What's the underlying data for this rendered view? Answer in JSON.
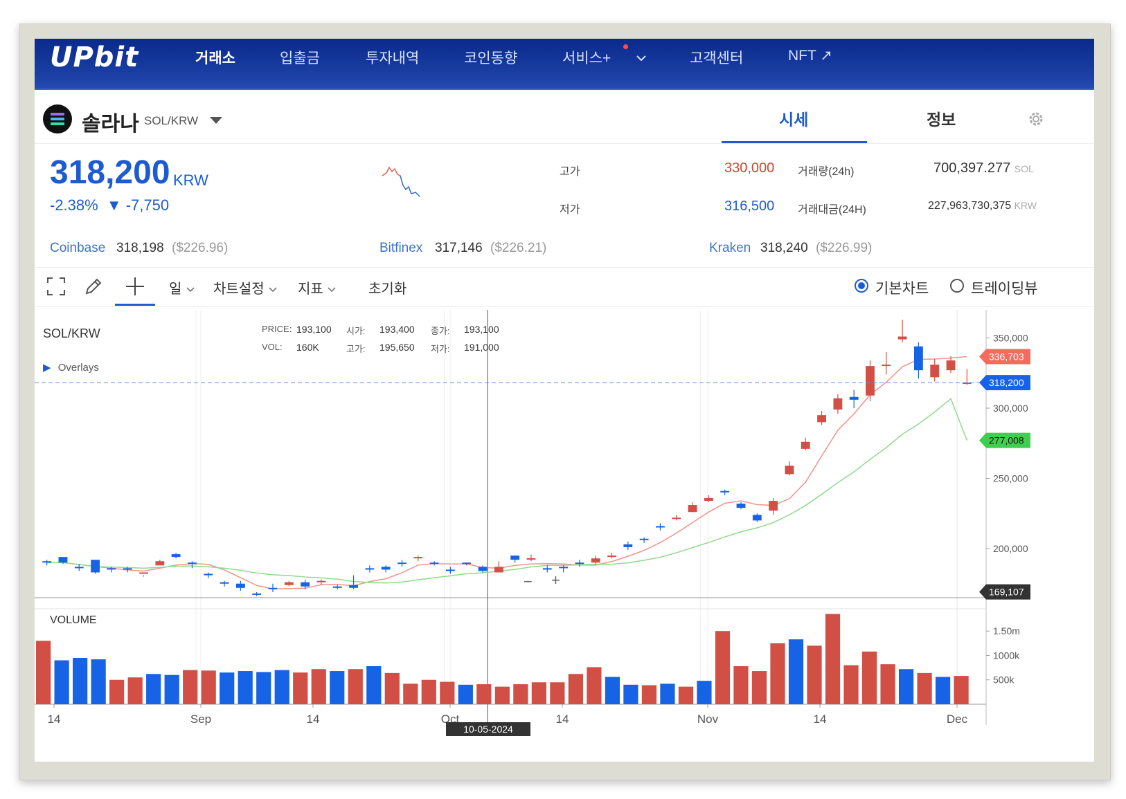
{
  "nav": {
    "logo": "UPbit",
    "items": [
      {
        "label": "거래소",
        "active": true
      },
      {
        "label": "입출금",
        "active": false
      },
      {
        "label": "투자내역",
        "active": false
      },
      {
        "label": "코인동향",
        "active": false
      },
      {
        "label": "서비스+",
        "active": false
      },
      {
        "label": "고객센터",
        "active": false
      },
      {
        "label": "NFT ↗",
        "active": false
      }
    ]
  },
  "coin": {
    "name": "솔라나",
    "pair": "SOL/KRW",
    "tabs": [
      "시세",
      "정보"
    ]
  },
  "price": {
    "current": "318,200",
    "unit": "KRW",
    "change_pct": "-2.38%",
    "change_abs": "▼ -7,750"
  },
  "stats": {
    "high_label": "고가",
    "high": "330,000",
    "low_label": "저가",
    "low": "316,500",
    "volume_label": "거래량(24h)",
    "volume": "700,397.277",
    "volume_unit": "SOL",
    "amount_label": "거래대금(24H)",
    "amount": "227,963,730,375",
    "amount_unit": "KRW"
  },
  "exchanges": [
    {
      "name": "Coinbase",
      "price": "318,198",
      "usd": "($226.96)"
    },
    {
      "name": "Bitfinex",
      "price": "317,146",
      "usd": "($226.21)"
    },
    {
      "name": "Kraken",
      "price": "318,240",
      "usd": "($226.99)"
    }
  ],
  "toolbar": {
    "interval": "일",
    "chart_settings": "차트설정",
    "indicators": "지표",
    "reset": "초기화",
    "basic_chart": "기본차트",
    "tradingview": "트레이딩뷰"
  },
  "chart_data": {
    "type": "candlestick",
    "symbol": "SOL/KRW",
    "overlays_label": "Overlays",
    "volume_label": "VOLUME",
    "tooltip": {
      "price_label": "PRICE:",
      "price": "193,100",
      "open_label": "시가:",
      "open": "193,400",
      "close_label": "종가:",
      "close": "193,100",
      "vol_label": "VOL:",
      "vol": "160K",
      "high_label": "고가:",
      "high": "195,650",
      "low_label": "저가:",
      "low": "191,000"
    },
    "y_ticks": [
      "350,000",
      "300,000",
      "250,000",
      "200,000"
    ],
    "y_tick_values": [
      350000,
      300000,
      250000,
      200000
    ],
    "ylim": [
      165000,
      368000
    ],
    "vol_ticks": [
      "1.50m",
      "1000k",
      "500k"
    ],
    "vol_tick_values": [
      1500000,
      1000000,
      500000
    ],
    "vol_max": 1900000,
    "x_labels": [
      "14",
      "Sep",
      "14",
      "Oct",
      "14",
      "Nov",
      "14",
      "Dec"
    ],
    "x_label_index": [
      0,
      19,
      33,
      49,
      63,
      80,
      94,
      111
    ],
    "crosshair_date": "10-05-2024",
    "crosshair_index": 53,
    "current_price": 318200,
    "current_price_label": "318,200",
    "ma_short_last": 336703,
    "ma_short_label": "336,703",
    "ma_long_last": 277008,
    "ma_long_label": "277,008",
    "bottom_marker": 169107,
    "bottom_marker_label": "169,107",
    "candles": [
      [
        185000,
        190000,
        183000,
        191000,
        180000,
        191000,
        190000,
        192000,
        188000
      ],
      [
        187000,
        190000,
        186000,
        192000,
        185000,
        194000,
        190000,
        191000,
        189000
      ],
      [
        190000,
        187000,
        185000,
        193000,
        184000,
        187000,
        186000,
        189000,
        184000
      ],
      [
        187000,
        183000,
        181000,
        188000,
        180000,
        192000,
        183000,
        184000,
        182000
      ],
      [
        183000,
        185000,
        181000,
        186000,
        182000,
        186000,
        185000,
        187000,
        183000
      ],
      [
        185000,
        186000,
        183000,
        187000,
        186000,
        186000,
        185000,
        187000,
        183000
      ],
      [
        185000,
        184000,
        182000,
        186000,
        184000,
        182000,
        183000,
        181000,
        180000
      ],
      [
        182000,
        183000,
        181000,
        184000,
        183000,
        188000,
        191000,
        192000,
        189000
      ],
      [
        191000,
        195000,
        189000,
        196000,
        195000,
        196000,
        194000,
        197000,
        193000
      ],
      [
        195000,
        194000,
        192000,
        196000,
        194000,
        190000,
        189000,
        191000,
        186000
      ],
      [
        189000,
        186000,
        184000,
        190000,
        186000,
        182000,
        181000,
        183000,
        179000
      ],
      [
        181000,
        178000,
        176000,
        182000,
        178000,
        176000,
        175000,
        177000,
        173000
      ],
      [
        175000,
        174000,
        171000,
        176000,
        173000,
        175000,
        172000,
        177000,
        170000
      ],
      [
        172000,
        171000,
        170000,
        174000,
        171000,
        168000,
        167000,
        169000,
        166000
      ],
      [
        167000,
        170000,
        166000,
        172000,
        170000,
        172000,
        171000,
        175000,
        169000
      ],
      [
        171000,
        175000,
        170000,
        177000,
        175000,
        174000,
        176000,
        177000,
        173000
      ],
      [
        176000,
        176000,
        173000,
        178000,
        176000,
        176000,
        173000,
        178000,
        171000
      ],
      [
        173000,
        177000,
        172000,
        178000,
        177000,
        176000,
        177000,
        178000,
        174000
      ],
      [
        177000,
        175000,
        173000,
        178000,
        175000,
        173000,
        172000,
        174000,
        171000
      ],
      [
        172000,
        173000,
        171000,
        175000,
        173000,
        174000,
        172000,
        181000,
        171000
      ],
      [
        172000,
        181000,
        170000,
        183000,
        181000,
        186000,
        185000,
        188000,
        183000
      ],
      [
        185000,
        186000,
        183000,
        188000,
        186000,
        187000,
        185000,
        188000,
        183000
      ],
      [
        185000,
        189000,
        184000,
        191000,
        189000,
        190000,
        189000,
        192000,
        187000
      ],
      [
        189000,
        190000,
        187000,
        192000,
        190000,
        193000,
        194000,
        195000,
        191000
      ],
      [
        194000,
        193000,
        192000,
        195000,
        193000,
        190000,
        189000,
        191000,
        188000
      ],
      [
        189000,
        186000,
        184000,
        190000,
        186000,
        185000,
        184000,
        187000,
        182000
      ],
      [
        184000,
        187000,
        183000,
        188000,
        187000,
        190000,
        189000,
        190000,
        188000
      ],
      [
        189000,
        185000,
        183000,
        190000,
        185000,
        187000,
        184000,
        188000,
        183000
      ],
      [
        184000,
        185000,
        183000,
        187000,
        185000,
        183000,
        187000,
        191000,
        186000
      ],
      [
        187000,
        191000,
        186000,
        193000,
        191000,
        195000,
        192000,
        195000,
        190000
      ],
      [
        192000,
        193000,
        190000,
        195000,
        193000,
        193100,
        193100,
        195650,
        191000
      ],
      [
        193100,
        190000,
        188000,
        194000,
        190000,
        186000,
        185000,
        188000,
        183000
      ],
      [
        185000,
        184000,
        182000,
        186000,
        184000,
        187000,
        186000,
        188000,
        183000
      ],
      [
        186000,
        188000,
        185000,
        189000,
        188000,
        190000,
        189000,
        192000,
        187000
      ],
      [
        189000,
        192000,
        188000,
        193000,
        192000,
        190000,
        193000,
        195000,
        189000
      ],
      [
        193000,
        191000,
        189000,
        195000,
        191000,
        194000,
        195000,
        197000,
        193000
      ],
      [
        195000,
        200000,
        194000,
        202000,
        200000,
        203000,
        201000,
        205000,
        199000
      ],
      [
        201000,
        206000,
        200000,
        207000,
        206000,
        207000,
        206000,
        208000,
        204000
      ],
      [
        206000,
        208000,
        204000,
        211000,
        208000,
        216000,
        215000,
        218000,
        213000
      ],
      [
        215000,
        219000,
        214000,
        221000,
        219000,
        221000,
        222000,
        224000,
        220000
      ],
      [
        222000,
        227000,
        220000,
        229000,
        227000,
        226000,
        231000,
        233000,
        229000
      ],
      [
        231000,
        229000,
        223000,
        232000,
        229000,
        234000,
        236000,
        238000,
        233000
      ],
      [
        236000,
        240000,
        235000,
        242000,
        240000,
        241000,
        240000,
        242000,
        238000
      ],
      [
        240000,
        235000,
        232000,
        241000,
        235000,
        232000,
        229000,
        233000,
        228000
      ],
      [
        229000,
        226000,
        224000,
        230000,
        226000,
        224000,
        220000,
        225000,
        219000
      ],
      [
        220000,
        225000,
        218000,
        226000,
        225000,
        227000,
        234000,
        236000,
        224000
      ],
      [
        234000,
        248000,
        232000,
        250000,
        248000,
        253000,
        259000,
        262000,
        252000
      ],
      [
        259000,
        268000,
        257000,
        270000,
        268000,
        271000,
        276000,
        279000,
        270000
      ],
      [
        276000,
        282000,
        274000,
        285000,
        282000,
        290000,
        295000,
        298000,
        288000
      ],
      [
        295000,
        312000,
        293000,
        320000,
        312000,
        299000,
        307000,
        310000,
        296000
      ],
      [
        307000,
        304000,
        298000,
        316000,
        304000,
        308000,
        306000,
        313000,
        300000
      ],
      [
        306000,
        302000,
        298000,
        310000,
        302000,
        309000,
        330000,
        334000,
        305000
      ],
      [
        330000,
        331000,
        322000,
        334000,
        331000,
        330000,
        331000,
        340000,
        324000
      ],
      [
        331000,
        350000,
        327000,
        356000,
        350000,
        349000,
        351000,
        363000,
        347000
      ],
      [
        351000,
        348000,
        340000,
        361000,
        348000,
        344000,
        327000,
        347000,
        321000
      ],
      [
        327000,
        325000,
        313000,
        330000,
        325000,
        322000,
        331000,
        335000,
        319000
      ],
      [
        331000,
        333000,
        326000,
        336000,
        333000,
        327000,
        334000,
        337000,
        325000
      ],
      [
        334000,
        326000,
        322000,
        335000,
        326000,
        318200,
        318200,
        328000,
        316500
      ]
    ],
    "volumes": [
      [
        1300000,
        "up"
      ],
      [
        900000,
        "down"
      ],
      [
        950000,
        "down"
      ],
      [
        920000,
        "down"
      ],
      [
        500000,
        "up"
      ],
      [
        550000,
        "up"
      ],
      [
        620000,
        "down"
      ],
      [
        600000,
        "down"
      ],
      [
        700000,
        "up"
      ],
      [
        690000,
        "up"
      ],
      [
        650000,
        "down"
      ],
      [
        680000,
        "down"
      ],
      [
        660000,
        "down"
      ],
      [
        700000,
        "down"
      ],
      [
        650000,
        "up"
      ],
      [
        720000,
        "up"
      ],
      [
        680000,
        "down"
      ],
      [
        720000,
        "up"
      ],
      [
        780000,
        "down"
      ],
      [
        640000,
        "up"
      ],
      [
        420000,
        "up"
      ],
      [
        500000,
        "up"
      ],
      [
        460000,
        "up"
      ],
      [
        400000,
        "down"
      ],
      [
        410000,
        "up"
      ],
      [
        360000,
        "up"
      ],
      [
        410000,
        "up"
      ],
      [
        450000,
        "up"
      ],
      [
        450000,
        "up"
      ],
      [
        620000,
        "up"
      ],
      [
        760000,
        "up"
      ],
      [
        560000,
        "down"
      ],
      [
        400000,
        "down"
      ],
      [
        390000,
        "up"
      ],
      [
        420000,
        "down"
      ],
      [
        360000,
        "up"
      ],
      [
        480000,
        "down"
      ],
      [
        1500000,
        "up"
      ],
      [
        780000,
        "up"
      ],
      [
        680000,
        "up"
      ],
      [
        1250000,
        "up"
      ],
      [
        1330000,
        "down"
      ],
      [
        1200000,
        "up"
      ],
      [
        1850000,
        "up"
      ],
      [
        800000,
        "up"
      ],
      [
        1080000,
        "up"
      ],
      [
        820000,
        "up"
      ],
      [
        720000,
        "down"
      ],
      [
        640000,
        "up"
      ],
      [
        560000,
        "down"
      ],
      [
        580000,
        "up"
      ]
    ]
  }
}
